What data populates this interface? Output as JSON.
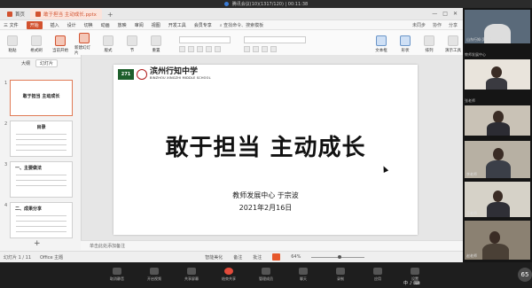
{
  "meeting": {
    "title": "腾讯会议(10)(1317/120) | 00:11:38"
  },
  "tabs": {
    "home": "首页",
    "doc": "敢于担当 主动成长.pptx",
    "plus": "+"
  },
  "menu": {
    "file": "三 文件",
    "items": [
      "开始",
      "插入",
      "设计",
      "切换",
      "动画",
      "放映",
      "审阅",
      "视图",
      "开发工具",
      "会员专享"
    ],
    "search": "查找命令、搜索模板",
    "right": [
      "未同步",
      "协作",
      "分享"
    ]
  },
  "ribbon": {
    "buttons": [
      {
        "label": "粘贴",
        "tone": "plain"
      },
      {
        "label": "格式刷",
        "tone": "plain"
      },
      {
        "label": "当前开始",
        "tone": "red"
      },
      {
        "label": "新建幻灯片",
        "tone": "red"
      },
      {
        "label": "版式",
        "tone": "plain"
      },
      {
        "label": "节",
        "tone": "plain"
      },
      {
        "label": "重置",
        "tone": "plain"
      }
    ],
    "right_buttons": [
      {
        "label": "文本框",
        "tone": "blue"
      },
      {
        "label": "形状",
        "tone": "blue"
      },
      {
        "label": "排列",
        "tone": "plain"
      },
      {
        "label": "演示工具",
        "tone": "plain"
      }
    ]
  },
  "panel": {
    "outline": "大纲",
    "slides": "幻灯片"
  },
  "thumbs": [
    {
      "num": "1",
      "title": "敢于担当 主动成长"
    },
    {
      "num": "2",
      "title": "目录"
    },
    {
      "num": "3",
      "title": "一、主要做法"
    },
    {
      "num": "4",
      "title": "二、成果分享"
    }
  ],
  "slide": {
    "badge": "271",
    "school_cn": "滨州行知中学",
    "school_en": "BINZHOU XINGZHI MIDDLE SCHOOL",
    "title": "敢于担当  主动成长",
    "author": "教师发展中心  于宗波",
    "date": "2021年2月16日"
  },
  "notes": {
    "placeholder": "单击此处添加备注",
    "add": "+"
  },
  "status": {
    "slide_count": "幻灯片 1 / 11",
    "theme": "Office 主题",
    "smart": "智能美化",
    "notes": "备注",
    "comment": "批注",
    "zoom": "64%"
  },
  "participants": [
    {
      "name": "山东行知·滨州行知中学"
    },
    {
      "name": "教师发展中心"
    },
    {
      "name": "张老师"
    },
    {
      "name": "李老师"
    },
    {
      "name": "王老师"
    },
    {
      "name": "赵老师"
    }
  ],
  "bottombar": [
    "取消静音",
    "开启视频",
    "共享屏幕",
    "结束共享",
    "管理成员",
    "聊天",
    "录制",
    "应用",
    "设置"
  ],
  "taskbar": {
    "ime": "中 ♪ ⌨",
    "badge": "65"
  }
}
